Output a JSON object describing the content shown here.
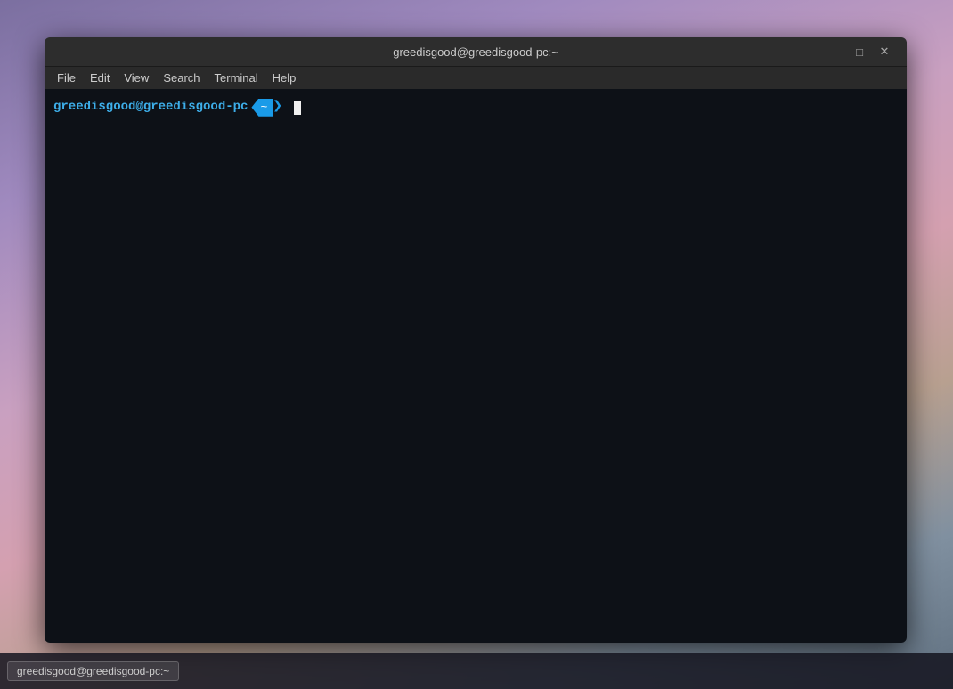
{
  "desktop": {
    "background": "purple-mountain"
  },
  "terminal": {
    "title": "greedisgood@greedisgood-pc:~",
    "window_controls": {
      "minimize": "–",
      "maximize": "□",
      "close": "✕"
    },
    "menu": {
      "items": [
        "File",
        "Edit",
        "View",
        "Search",
        "Terminal",
        "Help"
      ]
    },
    "prompt": {
      "user_host": "greedisgood@greedisgood-pc",
      "badge_text": "~",
      "separator": ">",
      "cursor": ""
    }
  },
  "taskbar": {
    "items": []
  }
}
